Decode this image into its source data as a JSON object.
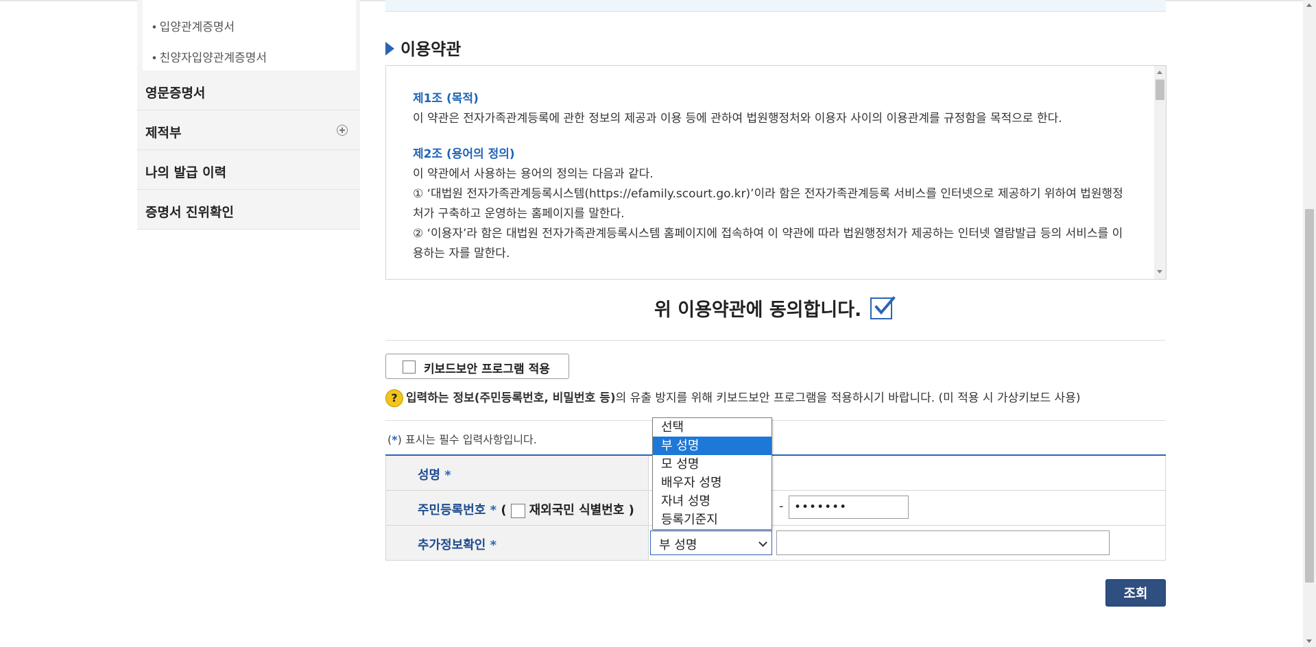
{
  "sidebar": {
    "sub_items": [
      "• 입양관계증명서",
      "• 친양자입양관계증명서"
    ],
    "items": [
      {
        "label": "영문증명서",
        "icon": ""
      },
      {
        "label": "제적부",
        "icon": "plus-circle-icon"
      },
      {
        "label": "나의 발급 이력",
        "icon": ""
      },
      {
        "label": "증명서 진위확인",
        "icon": ""
      }
    ]
  },
  "terms": {
    "section_title": "이용약관",
    "articles": [
      {
        "title": "제1조 (목적)",
        "lines": [
          "이 약관은 전자가족관계등록에 관한 정보의 제공과 이용 등에 관하여 법원행정처와 이용자 사이의 이용관계를 규정함을 목적으로 한다."
        ]
      },
      {
        "title": "제2조 (용어의 정의)",
        "lines": [
          "이 약관에서 사용하는 용어의 정의는 다음과 같다.",
          "① ‘대법원 전자가족관계등록시스템(https://efamily.scourt.go.kr)’이라 함은 전자가족관계등록 서비스를 인터넷으로 제공하기 위하여 법원행정처가 구축하고 운영하는 홈페이지를 말한다.",
          "② ‘이용자’라 함은 대법원 전자가족관계등록시스템 홈페이지에 접속하여 이 약관에 따라 법원행정처가 제공하는 인터넷 열람발급 등의 서비스를 이용하는 자를 말한다."
        ]
      }
    ],
    "agree_label": "위 이용약관에 동의합니다.",
    "agree_checked": true
  },
  "keyboard": {
    "button_label": "키보드보안 프로그램 적용",
    "notice_bold": "입력하는 정보(주민등록번호, 비밀번호 등)",
    "notice_rest": "의 유출 방지를 위해 키보드보안 프로그램을 적용하시기 바랍니다. (미 적용 시 가상키보드 사용)"
  },
  "form": {
    "required_note_star": "*",
    "required_note_text": "표시는 필수 입력사항입니다.",
    "rows": {
      "name_label": "성명",
      "rrn_label": "주민등록번호",
      "foreign_label": "재외국민 식별번호",
      "rrn_back_value": "•••••••",
      "extra_label": "추가정보확인"
    },
    "required_star": "*",
    "dash": "-",
    "extra_select_value": "부 성명",
    "dropdown_options": [
      "선택",
      "부 성명",
      "모 성명",
      "배우자 성명",
      "자녀 성명",
      "등록기준지"
    ],
    "dropdown_selected_index": 1,
    "search_button": "조회"
  },
  "colors": {
    "accent_blue": "#2a63b7",
    "button_navy": "#2f4f80",
    "dropdown_highlight": "#1e78d7",
    "help_yellow": "#f3c41b"
  }
}
